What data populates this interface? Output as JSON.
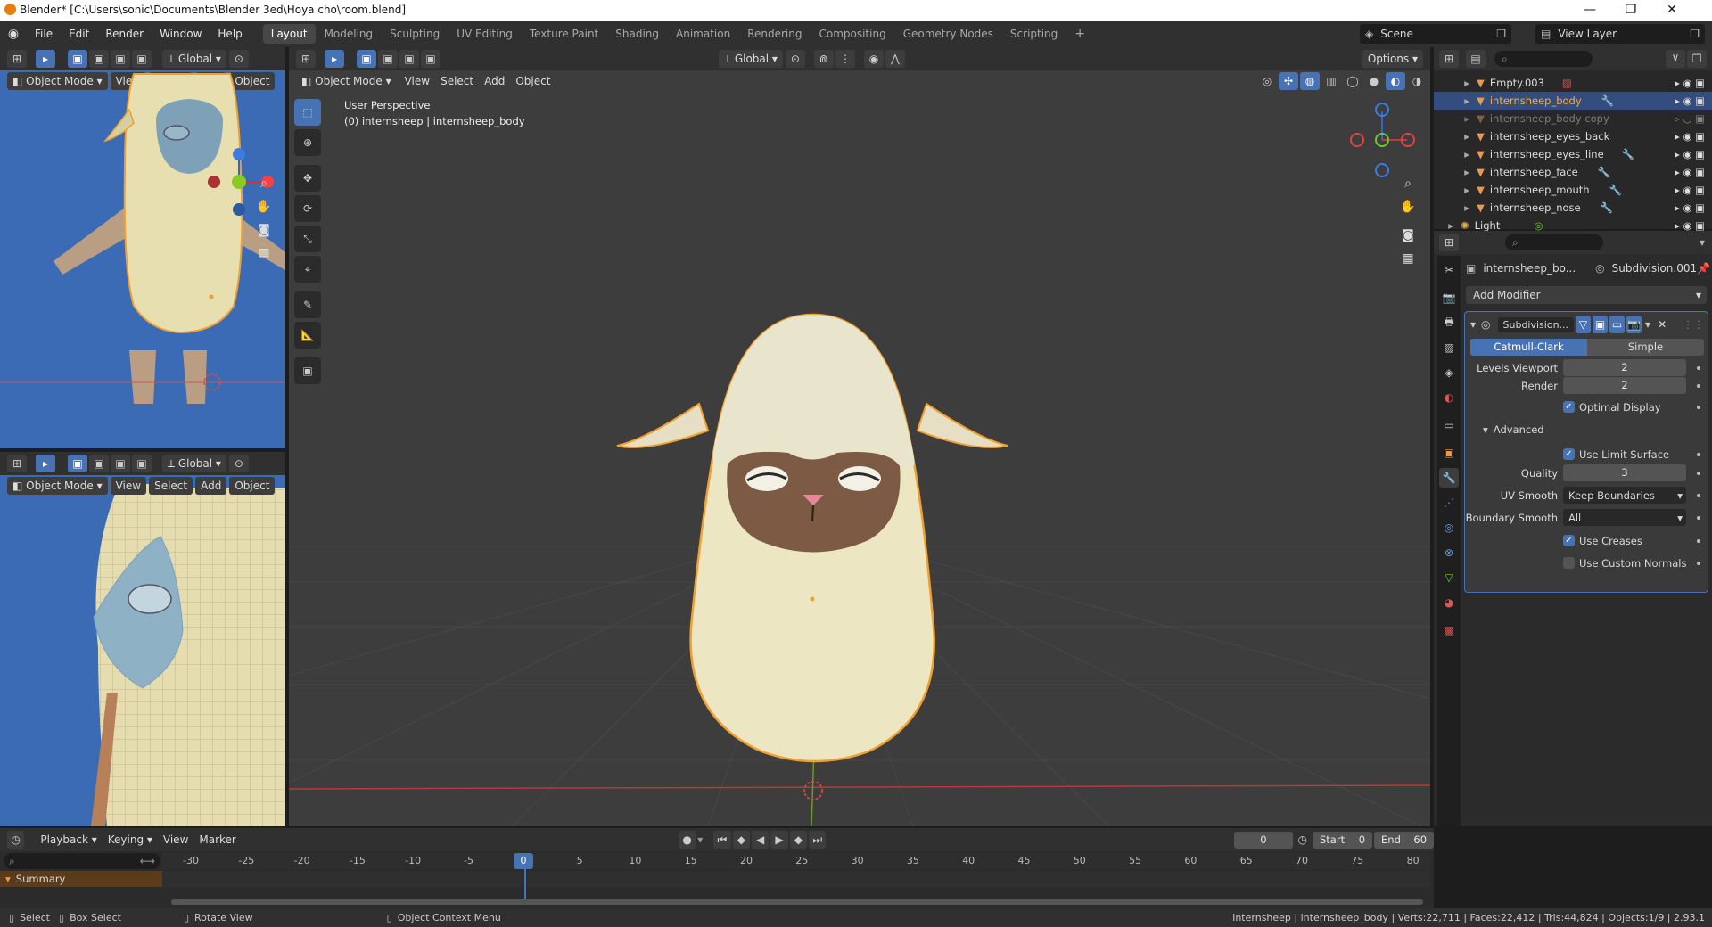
{
  "titlebar": {
    "title": "Blender* [C:\\Users\\sonic\\Documents\\Blender 3ed\\Hoya cho\\room.blend]"
  },
  "menu": {
    "items": [
      "File",
      "Edit",
      "Render",
      "Window",
      "Help"
    ]
  },
  "workspaces": [
    "Layout",
    "Modeling",
    "Sculpting",
    "UV Editing",
    "Texture Paint",
    "Shading",
    "Animation",
    "Rendering",
    "Compositing",
    "Geometry Nodes",
    "Scripting"
  ],
  "scene": {
    "label": "Scene",
    "view_layer": "View Layer"
  },
  "viewport_header": {
    "mode": "Object Mode",
    "view": "View",
    "select": "Select",
    "add": "Add",
    "object": "Object",
    "orientation": "Global",
    "options": "Options"
  },
  "main_viewport": {
    "line1": "User Perspective",
    "line2": "(0) internsheep | internsheep_body"
  },
  "outliner": {
    "rows": [
      {
        "name": "Empty.003"
      },
      {
        "name": "internsheep_body"
      },
      {
        "name": "internsheep_body copy"
      },
      {
        "name": "internsheep_eyes_back"
      },
      {
        "name": "internsheep_eyes_line"
      },
      {
        "name": "internsheep_face"
      },
      {
        "name": "internsheep_mouth"
      },
      {
        "name": "internsheep_nose"
      },
      {
        "name": "Light"
      }
    ]
  },
  "properties": {
    "object_name": "internsheep_bo...",
    "modifier_ref": "Subdivision.001",
    "add_modifier": "Add Modifier",
    "modifier_title": "Subdivision...",
    "tab_catmull": "Catmull-Clark",
    "tab_simple": "Simple",
    "levels_viewport_label": "Levels Viewport",
    "levels_viewport": "2",
    "render_label": "Render",
    "render_value": "2",
    "optimal_display": "Optimal Display",
    "advanced": "Advanced",
    "use_limit_surface": "Use Limit Surface",
    "quality_label": "Quality",
    "quality": "3",
    "uv_smooth_label": "UV Smooth",
    "uv_smooth": "Keep Boundaries",
    "boundary_smooth_label": "Boundary Smooth",
    "boundary_smooth": "All",
    "use_creases": "Use Creases",
    "use_custom_normals": "Use Custom Normals"
  },
  "timeline": {
    "playback": "Playback",
    "keying": "Keying",
    "view": "View",
    "marker": "Marker",
    "current_frame": "0",
    "start_label": "Start",
    "start": "0",
    "end_label": "End",
    "end": "60",
    "summary": "Summary",
    "ticks": [
      "-30",
      "-25",
      "-20",
      "-15",
      "-10",
      "-5",
      "0",
      "5",
      "10",
      "15",
      "20",
      "25",
      "30",
      "35",
      "40",
      "45",
      "50",
      "55",
      "60",
      "65",
      "70",
      "75",
      "80"
    ]
  },
  "statusbar": {
    "select": "Select",
    "box_select": "Box Select",
    "rotate_view": "Rotate View",
    "context_menu": "Object Context Menu",
    "stats": "internsheep | internsheep_body | Verts:22,711 | Faces:22,412 | Tris:44,824 | Objects:1/9 | 2.93.1"
  },
  "colors": {
    "accent": "#4772b3",
    "selection_orange": "#ffaf29",
    "viewport_bg": "#3d3d3d",
    "side_viewport_bg": "#3b6bb5"
  }
}
